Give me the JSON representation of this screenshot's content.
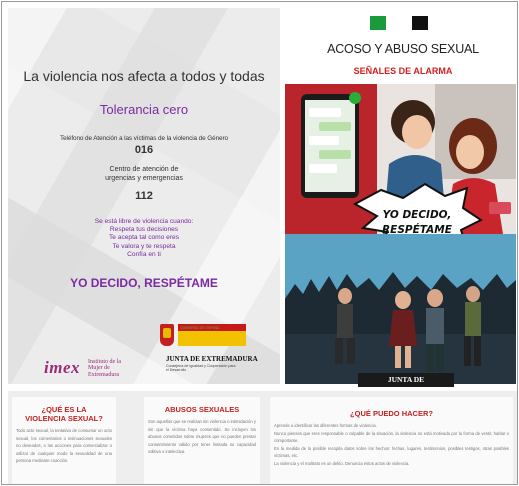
{
  "left_panel": {
    "headline": "La violencia nos afecta a todos y todas",
    "tolerance": "Tolerancia cero",
    "phone_label": "Teléfono de Atención a las víctimas de la violencia de Género",
    "phone_number": "016",
    "center_label_1": "Centro de atención de",
    "center_label_2": "urgencias y emergencias",
    "center_number": "112",
    "free_items": [
      "Se está libre de violencia cuando:",
      "Respeta tus decisiones",
      "Te acepta tal como eres",
      "Te valora y te respeta",
      "Confía en ti"
    ],
    "slogan": "YO DECIDO, RESPÉTAME"
  },
  "logos": {
    "imex_word": "imex",
    "imex_sub": "Instituto de la Mujer de Extremadura",
    "gobierno_text": "GOBIERNO DE ESPAÑA",
    "junta_left": "JUNTA DE EXTREMADURA",
    "junta_left_sub": "Consejería de Igualdad y Cooperación para el Desarrollo",
    "junta_right": "JUNTA DE EXTREMADURA"
  },
  "right_panel": {
    "title": "ACOSO Y ABUSO SEXUAL",
    "subtitle": "SEÑALES DE ALARMA",
    "bubble_text_1": "YO DECIDO,",
    "bubble_text_2": "RESPÉTAME",
    "flag_colors": [
      "#1a9a3a",
      "#111111"
    ]
  },
  "bottom": {
    "col1_title_1": "¿QUÉ ES LA",
    "col1_title_2": "VIOLENCIA SEXUAL?",
    "col1_text": "Todo acto sexual, la tentativa de consumar un acto sexual, los comentarios o insinuaciones sexuales no deseados, o las acciones para comercializar o utilizar de cualquier modo la sexualidad de una persona mediante coacción.",
    "col2_title": "ABUSOS SEXUALES",
    "col2_text": "Son aquellos que se realizan sin violencia o intimidación y sin que la víctima haya consentido. Se incluyen los abusos cometidos sobre mujeres que no pueden prestar consentimiento válido por tener limitada su capacidad volitiva o intelectiva.",
    "col3_title": "¿QUÉ PUEDO HACER?",
    "col3_lines": [
      "Aprende a identificar las diferentes formas de violencia.",
      "Nunca pienses que eres responsable o culpable de la situación, la violencia no está motivada por la forma de vestir, hablar o comportarse.",
      "En la medida de lo posible recopila datos sobre los hechos: fechas, lugares, testimonios, posibles testigos, otras posibles víctimas, etc.",
      "La violencia y el maltrato es un delito. Denuncia estos actos de violencia."
    ]
  },
  "colors": {
    "purple": "#7a2aa0",
    "red": "#d42020",
    "panel_bg": "#ececec"
  }
}
